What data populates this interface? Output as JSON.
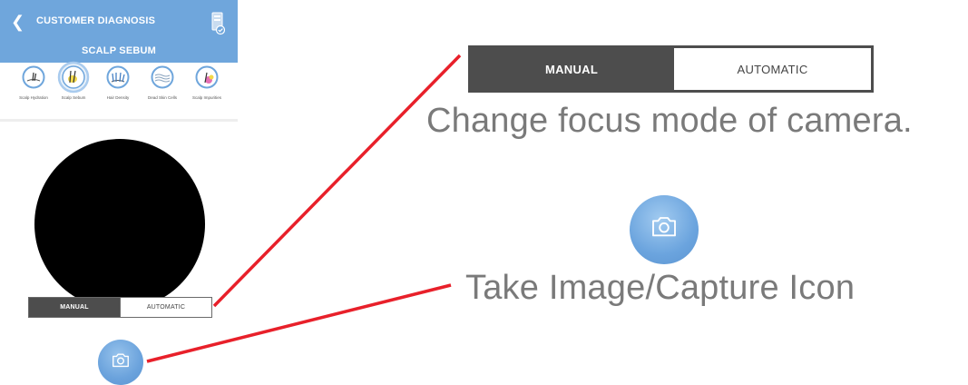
{
  "header": {
    "title": "CUSTOMER DIAGNOSIS",
    "subtitle": "SCALP SEBUM",
    "back_icon": "chevron-left-icon",
    "report_icon": "report-check-icon"
  },
  "categories": [
    {
      "label": "Scalp Hydration",
      "icon": "scalp-hydration-icon",
      "active": false
    },
    {
      "label": "Scalp Sebum",
      "icon": "scalp-sebum-icon",
      "active": true
    },
    {
      "label": "Hair Density",
      "icon": "hair-density-icon",
      "active": false
    },
    {
      "label": "Dead Skin Cells",
      "icon": "dead-skin-cells-icon",
      "active": false
    },
    {
      "label": "Scalp Impurities",
      "icon": "scalp-impurities-icon",
      "active": false
    }
  ],
  "focus_toggle": {
    "manual_label": "MANUAL",
    "automatic_label": "AUTOMATIC",
    "selected": "MANUAL"
  },
  "callouts": {
    "focus_caption": "Change focus mode of camera.",
    "capture_caption": "Take Image/Capture Icon"
  },
  "colors": {
    "header": "#6fa6dc",
    "toggle_active": "#4d4d4d",
    "callout_line": "#e8202a",
    "camera_button": "#6aa2dc",
    "caption_text": "#7a7a7a"
  }
}
